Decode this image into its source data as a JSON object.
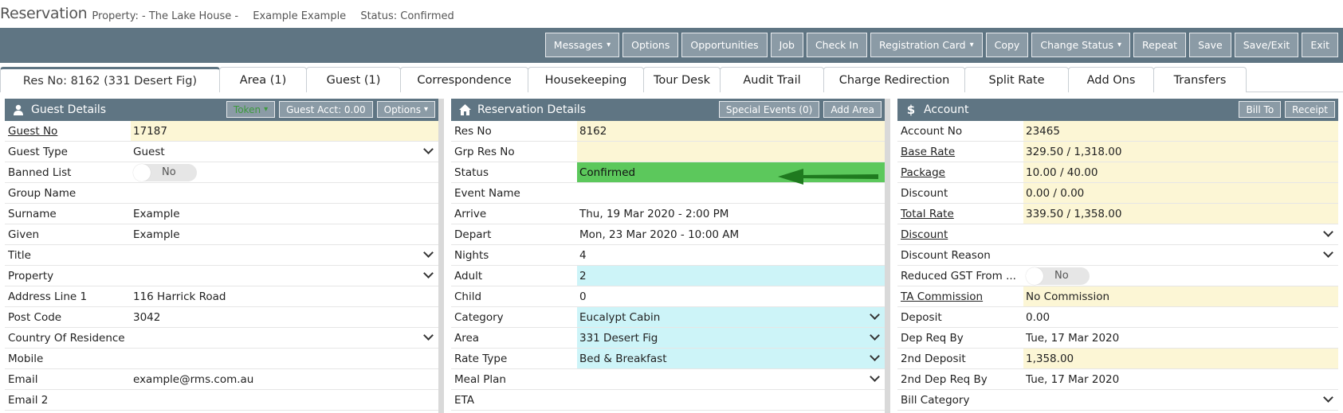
{
  "title": {
    "heading": "Reservation",
    "property_label": "Property: - The Lake House -",
    "guest_name": "Example Example",
    "status_label": "Status: Confirmed"
  },
  "toolbar": {
    "buttons": [
      {
        "label": "Messages",
        "dropdown": true
      },
      {
        "label": "Options",
        "dropdown": false
      },
      {
        "label": "Opportunities",
        "dropdown": false
      },
      {
        "label": "Job",
        "dropdown": false
      },
      {
        "label": "Check In",
        "dropdown": false
      },
      {
        "label": "Registration Card",
        "dropdown": true
      },
      {
        "label": "Copy",
        "dropdown": false
      },
      {
        "label": "Change Status",
        "dropdown": true
      },
      {
        "label": "Repeat",
        "dropdown": false
      },
      {
        "label": "Save",
        "dropdown": false
      },
      {
        "label": "Save/Exit",
        "dropdown": false
      },
      {
        "label": "Exit",
        "dropdown": false
      }
    ]
  },
  "tabs": [
    "Res No: 8162 (331 Desert Fig)",
    "Area (1)",
    "Guest (1)",
    "Correspondence",
    "Housekeeping",
    "Tour Desk",
    "Audit Trail",
    "Charge Redirection",
    "Split Rate",
    "Add Ons",
    "Transfers"
  ],
  "guest_panel": {
    "title": "Guest Details",
    "icon": "user-icon",
    "buttons": {
      "token": "Token",
      "guest_acct": "Guest Acct: 0.00",
      "options": "Options"
    },
    "rows": [
      {
        "label": "Guest No",
        "value": "17187",
        "link": true,
        "bg": "yellow"
      },
      {
        "label": "Guest Type",
        "value": "Guest",
        "select": true
      },
      {
        "label": "Banned List",
        "toggle": "No"
      },
      {
        "label": "Group Name",
        "value": ""
      },
      {
        "label": "Surname",
        "value": "Example"
      },
      {
        "label": "Given",
        "value": "Example"
      },
      {
        "label": "Title",
        "value": "",
        "select": true
      },
      {
        "label": "Property",
        "value": "",
        "select": true
      },
      {
        "label": "Address Line 1",
        "value": "116 Harrick Road"
      },
      {
        "label": "Post Code",
        "value": "3042"
      },
      {
        "label": "Country Of Residence",
        "value": "",
        "select": true
      },
      {
        "label": "Mobile",
        "value": ""
      },
      {
        "label": "Email",
        "value": "example@rms.com.au"
      },
      {
        "label": "Email 2",
        "value": ""
      }
    ]
  },
  "reservation_panel": {
    "title": "Reservation Details",
    "icon": "home-icon",
    "buttons": {
      "special_events": "Special Events (0)",
      "add_area": "Add Area"
    },
    "rows": [
      {
        "label": "Res No",
        "value": "8162",
        "bg": "yellow"
      },
      {
        "label": "Grp Res No",
        "value": "",
        "bg": "yellow"
      },
      {
        "label": "Status",
        "value": "Confirmed",
        "bg": "green"
      },
      {
        "label": "Event Name",
        "value": ""
      },
      {
        "label": "Arrive",
        "value": "Thu, 19 Mar 2020 - 2:00 PM"
      },
      {
        "label": "Depart",
        "value": "Mon, 23 Mar 2020 - 10:00 AM"
      },
      {
        "label": "Nights",
        "value": "4"
      },
      {
        "label": "Adult",
        "value": "2",
        "bg": "cyan"
      },
      {
        "label": "Child",
        "value": "0"
      },
      {
        "label": "Category",
        "value": "Eucalypt Cabin",
        "bg": "cyan",
        "select": true
      },
      {
        "label": "Area",
        "value": "331 Desert Fig",
        "bg": "cyan",
        "select": true
      },
      {
        "label": "Rate Type",
        "value": "Bed & Breakfast",
        "bg": "cyan",
        "select": true
      },
      {
        "label": "Meal Plan",
        "value": "",
        "select": true
      },
      {
        "label": "ETA",
        "value": ""
      }
    ]
  },
  "account_panel": {
    "title": "Account",
    "icon": "dollar-icon",
    "buttons": {
      "bill_to": "Bill To",
      "receipt": "Receipt"
    },
    "rows": [
      {
        "label": "Account No",
        "value": "23465",
        "bg": "yellow"
      },
      {
        "label": "Base Rate",
        "value": "329.50 / 1,318.00",
        "link": true,
        "bg": "yellow"
      },
      {
        "label": "Package",
        "value": "10.00 / 40.00",
        "link": true,
        "bg": "yellow"
      },
      {
        "label": "Discount",
        "value": "0.00 / 0.00",
        "bg": "yellow"
      },
      {
        "label": "Total Rate",
        "value": "339.50 / 1,358.00",
        "link": true,
        "bg": "yellow"
      },
      {
        "label": "Discount",
        "value": "",
        "link": true,
        "select": true
      },
      {
        "label": "Discount Reason",
        "value": "",
        "select": true
      },
      {
        "label": "Reduced GST From ...",
        "toggle": "No"
      },
      {
        "label": "TA Commission",
        "value": "No Commission",
        "link": true,
        "bg": "yellow"
      },
      {
        "label": "Deposit",
        "value": "0.00"
      },
      {
        "label": "Dep Req By",
        "value": "Tue, 17 Mar 2020"
      },
      {
        "label": "2nd Deposit",
        "value": "1,358.00",
        "bg": "yellow"
      },
      {
        "label": "2nd Dep Req By",
        "value": "Tue, 17 Mar 2020"
      },
      {
        "label": "Bill Category",
        "value": "",
        "select": true
      }
    ]
  },
  "colors": {
    "header": "#5f7583",
    "button": "#8b9ba6",
    "yellow": "#fcf6d5",
    "cyan": "#cdf4f8",
    "status_green": "#5cc85c",
    "arrow": "#1f7a1f"
  }
}
